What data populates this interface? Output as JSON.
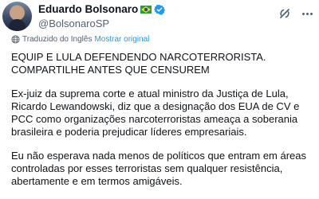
{
  "author": {
    "display_name": "Eduardo Bolsonaro",
    "handle": "@BolsonaroSP",
    "verified": true,
    "flag": "brazil-flag"
  },
  "header_actions": {
    "grok_icon": "grok-icon",
    "more_icon": "more-icon"
  },
  "translation": {
    "label": "Traduzido do Inglês",
    "show_original": "Mostrar original"
  },
  "tweet": {
    "paragraphs": [
      "EQUIP E LULA DEFENDENDO NARCOTERRORISTA. COMPARTILHE ANTES QUE CENSUREM",
      "Ex-juiz da suprema corte e atual ministro da Justiça de Lula, Ricardo Lewandowski, diz que a designação dos EUA de CV e PCC como organizações narcoterroristas ameaça a soberania brasileira e poderia prejudicar líderes empresariais.",
      "Eu não esperava nada menos de políticos que entram em áreas controladas por esses terroristas sem qualquer resistência, abertamente e em termos amigáveis."
    ]
  },
  "colors": {
    "text": "#0f1419",
    "secondary": "#536471",
    "link": "#1d9bf0",
    "verified": "#1d9bf0"
  }
}
